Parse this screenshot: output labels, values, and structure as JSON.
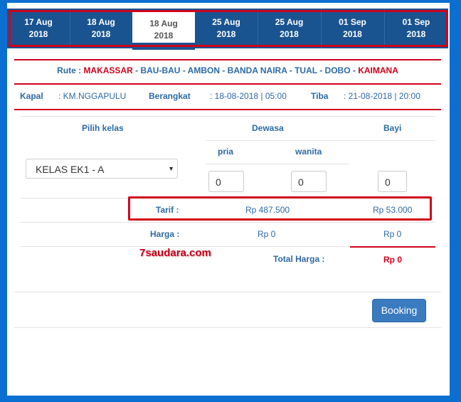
{
  "tabs": [
    {
      "day": "17 Aug",
      "year": "2018"
    },
    {
      "day": "18 Aug",
      "year": "2018"
    },
    {
      "day": "18 Aug",
      "year": "2018"
    },
    {
      "day": "25 Aug",
      "year": "2018"
    },
    {
      "day": "25 Aug",
      "year": "2018"
    },
    {
      "day": "01 Sep",
      "year": "2018"
    },
    {
      "day": "01 Sep",
      "year": "2018"
    }
  ],
  "route": {
    "label": "Rute :",
    "origin": "MAKASSAR",
    "middle": "- BAU-BAU - AMBON - BANDA NAIRA - TUAL - DOBO -",
    "destination": "KAIMANA"
  },
  "info": {
    "kapal_label": "Kapal",
    "kapal_value": ": KM.NGGAPULU",
    "berangkat_label": "Berangkat",
    "berangkat_value": ": 18-08-2018 | 05:00",
    "tiba_label": "Tiba",
    "tiba_value": ": 21-08-2018 | 20:00"
  },
  "table": {
    "pilih_kelas": "Pilih kelas",
    "dewasa": "Dewasa",
    "bayi": "Bayi",
    "pria": "pria",
    "wanita": "wanita",
    "kelas_selected": "KELAS EK1 - A",
    "pria_value": "0",
    "wanita_value": "0",
    "bayi_value": "0",
    "tarif_label": "Tarif :",
    "tarif_dewasa": "Rp 487.500",
    "tarif_bayi": "Rp 53.000",
    "harga_label": "Harga :",
    "harga_dewasa": "Rp 0",
    "harga_bayi": "Rp 0",
    "total_label": "Total Harga :",
    "total_value": "Rp 0"
  },
  "watermark": "7saudara.com",
  "booking_label": "Booking",
  "colors": {
    "accent": "#d0021b",
    "primary": "#1a5490",
    "button": "#3a7bbf"
  }
}
